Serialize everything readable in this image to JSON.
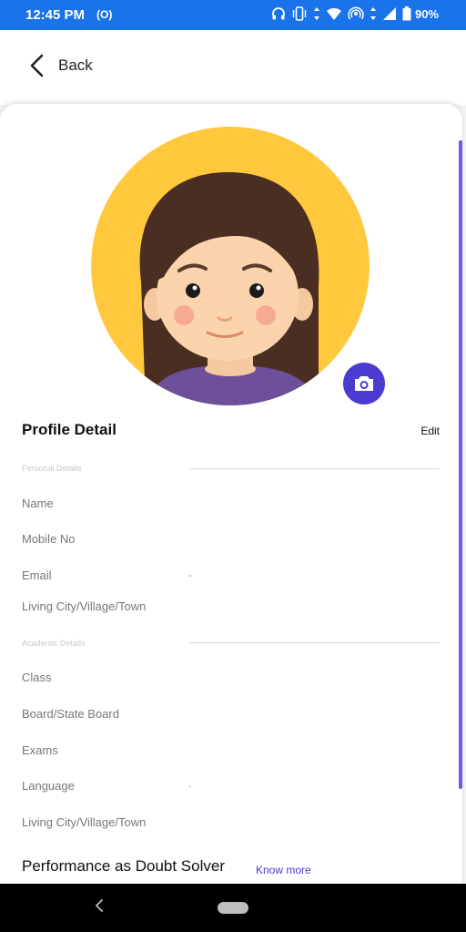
{
  "status_bar": {
    "time": "12:45 PM",
    "radio": "(O)",
    "battery": "90%"
  },
  "header": {
    "back_label": "Back"
  },
  "profile": {
    "title": "Profile Detail",
    "edit_label": "Edit",
    "personal_section": "Personal Details",
    "personal_fields": [
      {
        "label": "Name",
        "value": ""
      },
      {
        "label": "Mobile No",
        "value": ""
      },
      {
        "label": "Email",
        "value": "-"
      },
      {
        "label": "Living City/Village/Town",
        "value": ""
      }
    ],
    "academic_section": "Academic Details",
    "academic_fields": [
      {
        "label": "Class",
        "value": ""
      },
      {
        "label": "Board/State Board",
        "value": ""
      },
      {
        "label": "Exams",
        "value": ""
      },
      {
        "label": "Language",
        "value": "."
      },
      {
        "label": "Living City/Village/Town",
        "value": ""
      }
    ]
  },
  "performance": {
    "title": "Performance as Doubt Solver",
    "know_more": "Know more"
  },
  "colors": {
    "accent": "#4b3bd1",
    "status_bar": "#1a73e8",
    "avatar_bg": "#ffc83d"
  }
}
